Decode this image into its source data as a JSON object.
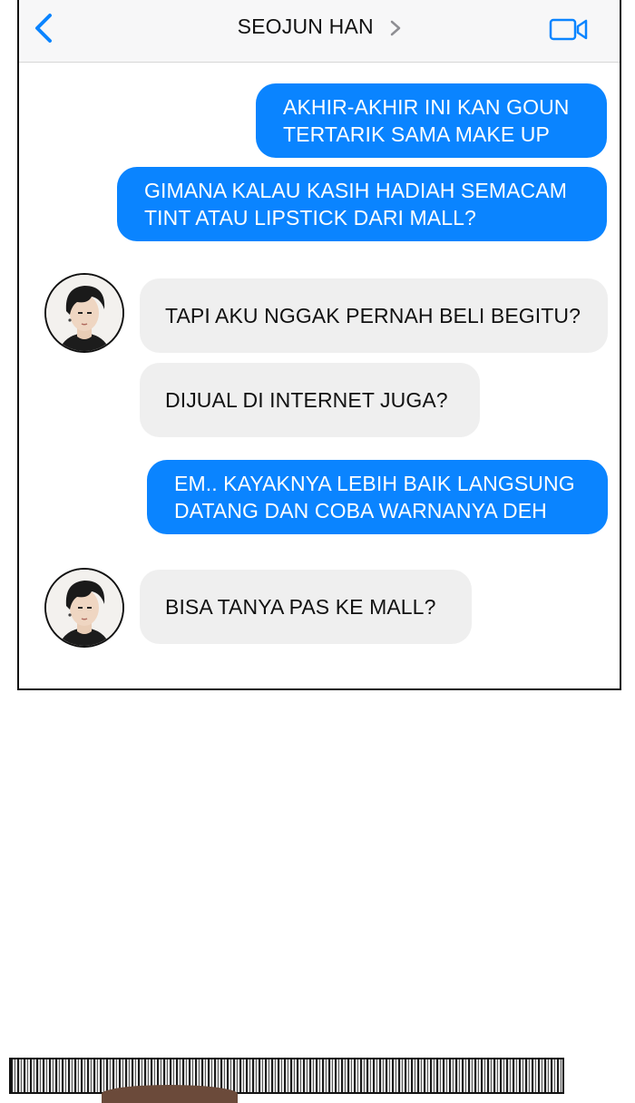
{
  "header": {
    "contact_name": "SEOJUN HAN",
    "icons": [
      "back-chevron-icon",
      "chevron-right-icon",
      "video-camera-icon"
    ],
    "accent_color": "#0a84ff"
  },
  "messages": [
    {
      "from": "me",
      "lines": [
        "AKHIR-AKHIR INI KAN GOUN",
        "TERTARIK SAMA MAKE UP"
      ]
    },
    {
      "from": "me",
      "lines": [
        "GIMANA KALAU KASIH HADIAH SEMACAM",
        "TINT ATAU LIPSTICK DARI MALL?"
      ]
    },
    {
      "from": "contact",
      "lines": [
        "TAPI AKU NGGAK PERNAH BELI BEGITU?"
      ]
    },
    {
      "from": "contact",
      "lines": [
        "DIJUAL DI INTERNET JUGA?"
      ]
    },
    {
      "from": "me",
      "lines": [
        "EM.. KAYAKNYA LEBIH BAIK LANGSUNG",
        "DATANG DAN COBA WARNANYA DEH"
      ]
    },
    {
      "from": "contact",
      "lines": [
        "BISA TANYA PAS KE MALL?"
      ]
    }
  ],
  "colors": {
    "sent_bubble": "#0a84ff",
    "received_bubble": "#efefef"
  }
}
